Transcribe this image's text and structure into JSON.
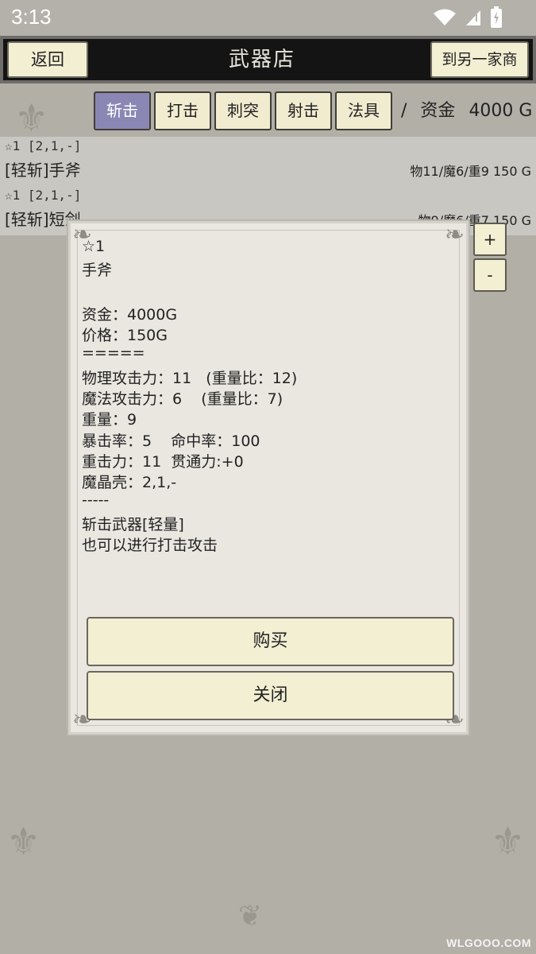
{
  "status_bar": {
    "time": "3:13",
    "icons": [
      "wifi-icon",
      "signal-icon",
      "battery-icon"
    ]
  },
  "header": {
    "title": "武器店",
    "back_label": "返回",
    "other_shop_label": "到另一家商"
  },
  "tabs": [
    {
      "label": "斩击",
      "active": true
    },
    {
      "label": "打击",
      "active": false
    },
    {
      "label": "刺突",
      "active": false
    },
    {
      "label": "射击",
      "active": false
    },
    {
      "label": "法具",
      "active": false
    }
  ],
  "funds": {
    "separator": "/",
    "label": "资金",
    "amount": "4000 G"
  },
  "items": [
    {
      "stars": "☆1 [2,1,-]",
      "name": "[轻斩]手斧",
      "stats": "物11/魔6/重9 150 G"
    },
    {
      "stars": "☆1 [2,1,-]",
      "name": "[轻斩]短剑",
      "stats": "物9/魔6/重7 150 G"
    }
  ],
  "side_buttons": {
    "plus": "+",
    "minus": "-"
  },
  "dialog": {
    "rank": "☆1",
    "name": "手斧",
    "funds_line": "资金：4000G",
    "price_line": "价格：150G",
    "sep1": "=====",
    "phys_line": "物理攻击力：11   (重量比：12)",
    "magic_line": "魔法攻击力：6    (重量比：7)",
    "weight_line": "重量：9",
    "crit_line": "暴击率：5    命中率：100",
    "heavy_line": "重击力：11  贯通力:+0",
    "crystal_line": "魔晶壳：2,1,-",
    "sep2": "-----",
    "desc1": "斩击武器[轻量]",
    "desc2": "也可以进行打击攻击",
    "buy_label": "购买",
    "close_label": "关闭"
  },
  "watermark": "WLGOOO.COM",
  "colors": {
    "active_tab": "#8a87b5",
    "button_bg": "#f3efd3",
    "header_bg": "#141414"
  }
}
